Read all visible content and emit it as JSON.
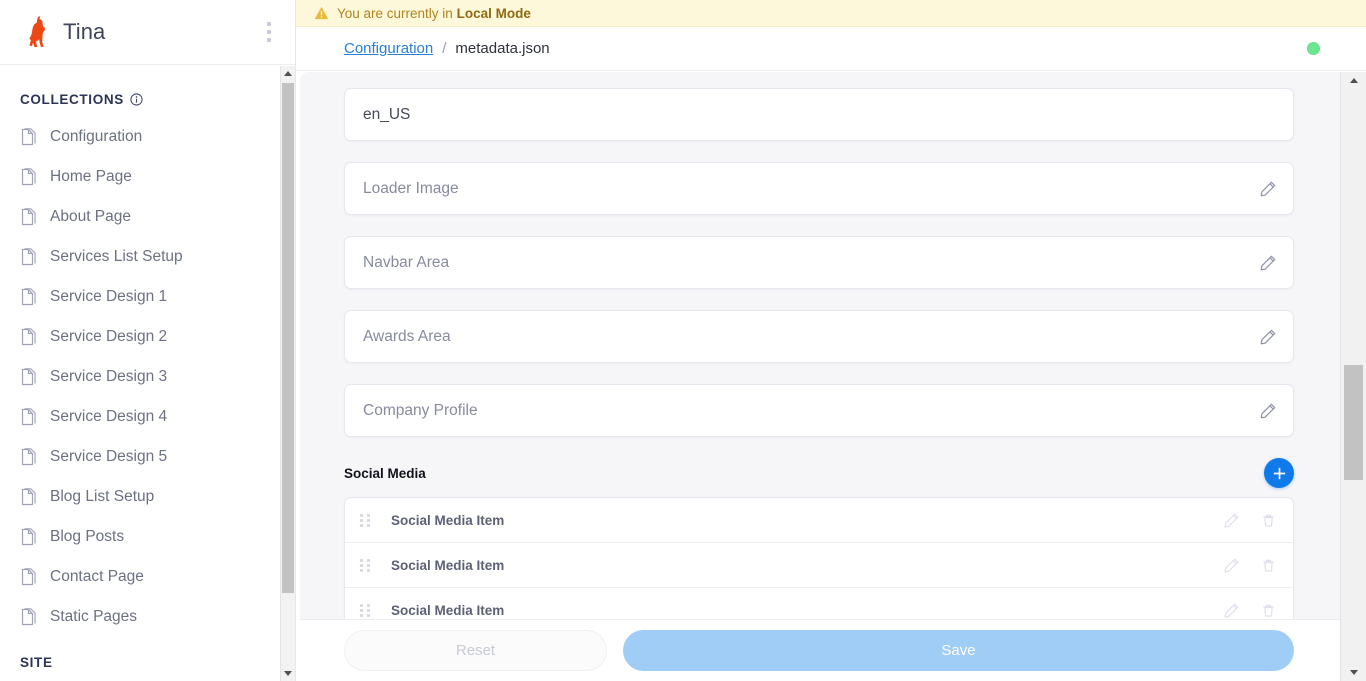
{
  "sidebar": {
    "brand": {
      "name": "Tina",
      "logo_icon": "llama-logo",
      "menu_icon": "kebab-menu-icon"
    },
    "collections_title": "COLLECTIONS",
    "collections_info_icon": "info-circle-icon",
    "items": [
      {
        "label": "Configuration",
        "icon": "document-icon"
      },
      {
        "label": "Home Page",
        "icon": "document-icon"
      },
      {
        "label": "About Page",
        "icon": "document-icon"
      },
      {
        "label": "Services List Setup",
        "icon": "document-icon"
      },
      {
        "label": "Service Design 1",
        "icon": "document-icon"
      },
      {
        "label": "Service Design 2",
        "icon": "document-icon"
      },
      {
        "label": "Service Design 3",
        "icon": "document-icon"
      },
      {
        "label": "Service Design 4",
        "icon": "document-icon"
      },
      {
        "label": "Service Design 5",
        "icon": "document-icon"
      },
      {
        "label": "Blog List Setup",
        "icon": "document-icon"
      },
      {
        "label": "Blog Posts",
        "icon": "document-icon"
      },
      {
        "label": "Contact Page",
        "icon": "document-icon"
      },
      {
        "label": "Static Pages",
        "icon": "document-icon"
      }
    ],
    "site_title": "SITE"
  },
  "banner": {
    "icon": "warning-triangle-icon",
    "text_prefix": "You are currently in ",
    "text_strong": "Local Mode",
    "bg_color": "#fdf8d9",
    "text_color": "#b08420"
  },
  "breadcrumb": {
    "parent": "Configuration",
    "separator": "/",
    "current": "metadata.json",
    "status_indicator": "green-status-dot",
    "status_color": "#6ce78f"
  },
  "form": {
    "fields": [
      {
        "kind": "value",
        "text": "en_US",
        "name": "locale-field"
      },
      {
        "kind": "group",
        "text": "Loader Image",
        "name": "loader-image-group",
        "edit_icon": "pencil-icon"
      },
      {
        "kind": "group",
        "text": "Navbar Area",
        "name": "navbar-area-group",
        "edit_icon": "pencil-icon"
      },
      {
        "kind": "group",
        "text": "Awards Area",
        "name": "awards-area-group",
        "edit_icon": "pencil-icon"
      },
      {
        "kind": "group",
        "text": "Company Profile",
        "name": "company-profile-group",
        "edit_icon": "pencil-icon"
      }
    ],
    "list_group": {
      "title": "Social Media",
      "add_icon": "plus-icon",
      "add_color": "#107aeb",
      "items": [
        {
          "label": "Social Media Item",
          "drag_icon": "drag-handle-icon",
          "edit_icon": "pencil-icon",
          "delete_icon": "trash-icon"
        },
        {
          "label": "Social Media Item",
          "drag_icon": "drag-handle-icon",
          "edit_icon": "pencil-icon",
          "delete_icon": "trash-icon"
        },
        {
          "label": "Social Media Item",
          "drag_icon": "drag-handle-icon",
          "edit_icon": "pencil-icon",
          "delete_icon": "trash-icon"
        }
      ]
    }
  },
  "actions": {
    "reset_label": "Reset",
    "save_label": "Save",
    "save_color": "#9fcdf6"
  }
}
